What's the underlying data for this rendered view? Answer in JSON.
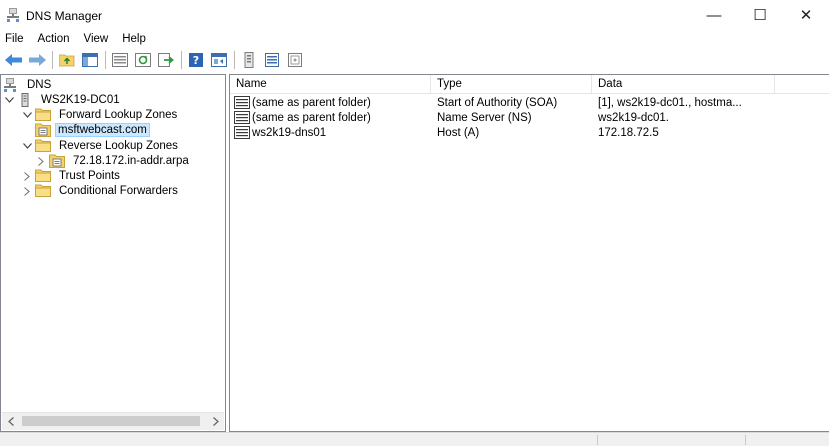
{
  "window": {
    "title": "DNS Manager",
    "minimize_glyph": "—",
    "maximize_glyph": "☐",
    "close_glyph": "✕"
  },
  "menu": [
    {
      "label": "File"
    },
    {
      "label": "Action"
    },
    {
      "label": "View"
    },
    {
      "label": "Help"
    }
  ],
  "toolbar": {
    "buttons": [
      "back-icon",
      "forward-icon",
      "up-folder-icon",
      "show-hide-tree-icon",
      "properties-icon",
      "refresh-icon",
      "export-list-icon",
      "help-icon",
      "mmc-icon",
      "new-record-icon",
      "list-view-icon",
      "detail-view-icon"
    ]
  },
  "tree": {
    "root": "DNS",
    "server": "WS2K19-DC01",
    "forward": "Forward Lookup Zones",
    "forward_zone": "msftwebcast.com",
    "reverse": "Reverse Lookup Zones",
    "reverse_zone": "72.18.172.in-addr.arpa",
    "trust": "Trust Points",
    "conditional": "Conditional Forwarders"
  },
  "list": {
    "columns": [
      "Name",
      "Type",
      "Data"
    ],
    "rows": [
      {
        "name": "(same as parent folder)",
        "type": "Start of Authority (SOA)",
        "data": "[1], ws2k19-dc01., hostma..."
      },
      {
        "name": "(same as parent folder)",
        "type": "Name Server (NS)",
        "data": "ws2k19-dc01."
      },
      {
        "name": "ws2k19-dns01",
        "type": "Host (A)",
        "data": "172.18.72.5"
      }
    ]
  },
  "colors": {
    "selection_bg": "#cce8ff",
    "folder_yellow": "#f4d26b",
    "pane_border": "#828790"
  }
}
